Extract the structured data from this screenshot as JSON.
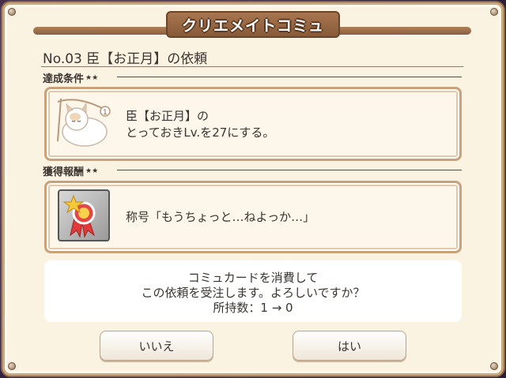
{
  "dialog": {
    "title": "クリエメイトコミュ",
    "request_title": "No.03 臣【お正月】の依頼"
  },
  "condition": {
    "label": "達成条件",
    "stars": "★★",
    "line1": "臣【お正月】の",
    "line2": "とっておきLv.を27にする。"
  },
  "reward": {
    "label": "獲得報酬",
    "stars": "★★",
    "text": "称号「もうちょっと…ねよっか…」"
  },
  "confirm": {
    "line1": "コミュカードを消費して",
    "line2": "この依頼を受注します。よろしいですか？",
    "line3": "所持数：1 → 0"
  },
  "buttons": {
    "no": "いいえ",
    "yes": "はい"
  },
  "colors": {
    "panel": "#fbf3e2",
    "frame": "#c9a77c",
    "title_plate": "#a87650",
    "text": "#3a3430"
  }
}
